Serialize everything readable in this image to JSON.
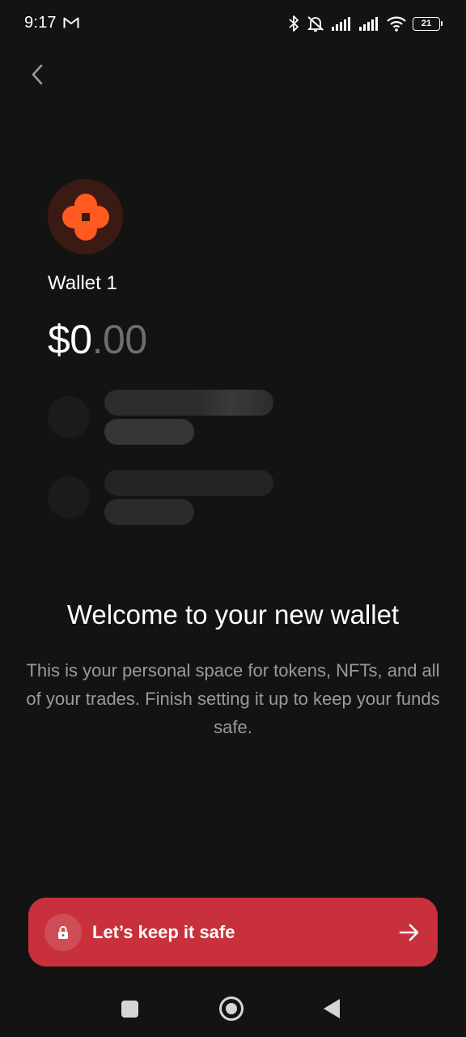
{
  "status_bar": {
    "time": "9:17",
    "battery": "21"
  },
  "wallet": {
    "name": "Wallet 1",
    "balance_whole": "$0",
    "balance_cents": ".00",
    "brand_color": "#ff5a1f"
  },
  "welcome": {
    "title": "Welcome to your new wallet",
    "body": "This is your personal space for tokens, NFTs, and all of your trades. Finish setting it up to keep your funds safe."
  },
  "cta": {
    "label": "Let’s keep it safe",
    "color": "#c8303b"
  },
  "icons": [
    "gmail-icon",
    "bluetooth-icon",
    "mute-icon",
    "signal-icon",
    "wifi-icon",
    "battery-icon",
    "back-icon",
    "lock-icon",
    "arrow-right-icon"
  ]
}
